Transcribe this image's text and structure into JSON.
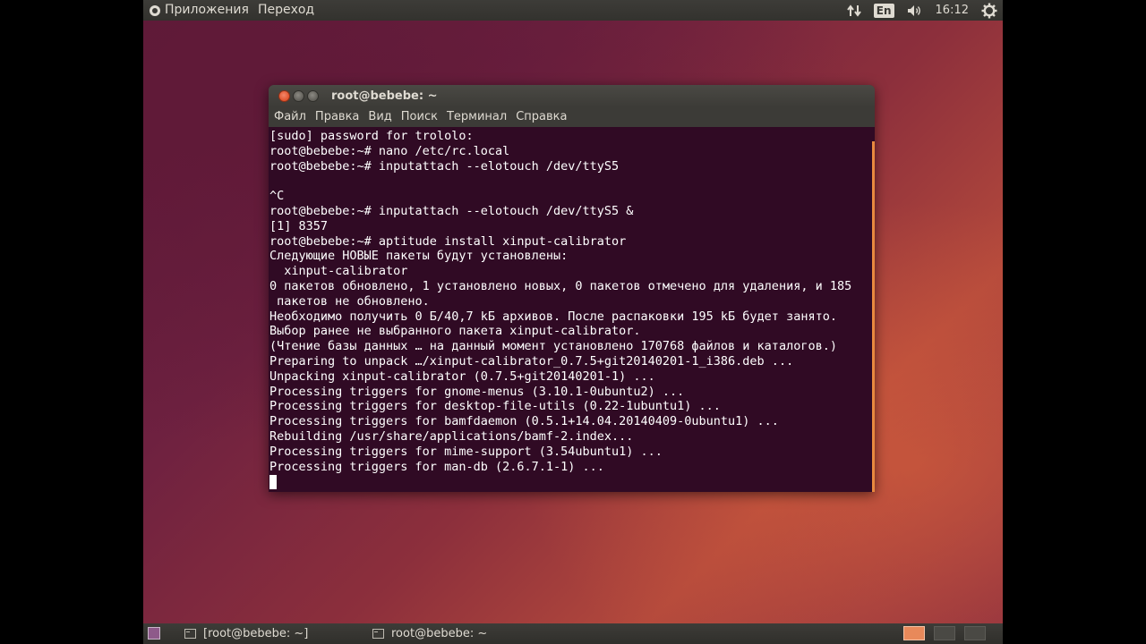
{
  "top_panel": {
    "menus": [
      "Приложения",
      "Переход"
    ],
    "keyboard_layout": "En",
    "clock": "16:12"
  },
  "window": {
    "title": "root@bebebe: ~",
    "menu": [
      "Файл",
      "Правка",
      "Вид",
      "Поиск",
      "Терминал",
      "Справка"
    ]
  },
  "terminal": {
    "lines": [
      "[sudo] password for trololo:",
      "root@bebebe:~# nano /etc/rc.local",
      "root@bebebe:~# inputattach --elotouch /dev/ttyS5",
      "",
      "^C",
      "root@bebebe:~# inputattach --elotouch /dev/ttyS5 &",
      "[1] 8357",
      "root@bebebe:~# aptitude install xinput-calibrator",
      "Следующие НОВЫЕ пакеты будут установлены:",
      "  xinput-calibrator",
      "0 пакетов обновлено, 1 установлено новых, 0 пакетов отмечено для удаления, и 185",
      " пакетов не обновлено.",
      "Необходимо получить 0 Б/40,7 kБ архивов. После распаковки 195 kБ будет занято.",
      "Выбор ранее не выбранного пакета xinput-calibrator.",
      "(Чтение базы данных … на данный момент установлено 170768 файлов и каталогов.)",
      "Preparing to unpack …/xinput-calibrator_0.7.5+git20140201-1_i386.deb ...",
      "Unpacking xinput-calibrator (0.7.5+git20140201-1) ...",
      "Processing triggers for gnome-menus (3.10.1-0ubuntu2) ...",
      "Processing triggers for desktop-file-utils (0.22-1ubuntu1) ...",
      "Processing triggers for bamfdaemon (0.5.1+14.04.20140409-0ubuntu1) ...",
      "Rebuilding /usr/share/applications/bamf-2.index...",
      "Processing triggers for mime-support (3.54ubuntu1) ...",
      "Processing triggers for man-db (2.6.7.1-1) ..."
    ]
  },
  "bottom_panel": {
    "tasks": [
      "[root@bebebe: ~]",
      "root@bebebe: ~"
    ]
  },
  "colors": {
    "terminal_bg": "#300a24",
    "accent": "#e8893f"
  }
}
